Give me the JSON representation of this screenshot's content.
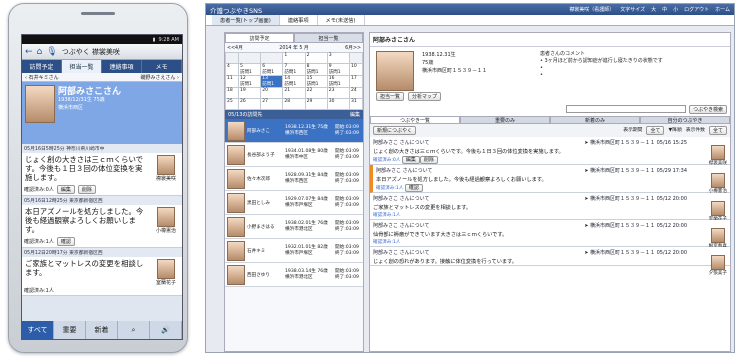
{
  "phone": {
    "status_time": "9:28 AM",
    "top_title": "つぶやく 襟裳美咲",
    "tabs": [
      "訪問予定",
      "担当一覧",
      "連絡事項",
      "メモ"
    ],
    "sub_left": "石井キミさん",
    "sub_right": "磯野みさえさん",
    "hero_name": "阿部みさこさん",
    "hero_meta": "1938/12/31生 75歳",
    "hero_city": "横浜市西区",
    "posts": [
      {
        "head": "05月16日5時25分 神奈川県川崎市中",
        "body": "じょく創の大きさは三ｃｍくらいです。今後も１日３回の体位変換を実施します。",
        "name": "襟裳美咲",
        "footer": [
          "確認済み:0人",
          "編集",
          "削除"
        ]
      },
      {
        "head": "05月16日12時25分 東京都新宿区西",
        "body": "本日アズノールを処方しました。今後も経過観察よろしくお願いします。",
        "name": "小樽憲治",
        "footer": [
          "確認済み:1人",
          "確認"
        ]
      },
      {
        "head": "05月12日20時17分 東京都新宿区西",
        "body": "ご家族とマットレスの変更を相談します。",
        "name": "室蘭花子",
        "footer": [
          "確認済み:1人"
        ]
      }
    ],
    "bottom": [
      "すべて",
      "重要",
      "新着"
    ]
  },
  "web": {
    "brand": "介護つぶやきSNS",
    "user": "襟裳美咲（看護師）",
    "links": [
      "文字サイズ",
      "大",
      "中",
      "小",
      "ログアウト",
      "ホーム"
    ],
    "nav": [
      "患者一覧(トップ画面)",
      "連絡事項",
      "メモ(未送信)"
    ],
    "left_tabs": [
      "訪問予定",
      "担当一覧"
    ],
    "month_label": "2014 年 5 月",
    "prev": "<<4月",
    "next": "6月>>",
    "visits_title": "05/13の訪問先",
    "visits_edit": "編集",
    "visits": [
      {
        "name": "阿部みさこ",
        "dob": "1938.12.31生 75歳",
        "city": "横浜市西区",
        "time": "開始:03:09 終了:03:09"
      },
      {
        "name": "長谷部よう子",
        "dob": "1934.01.08生 80歳",
        "city": "横浜市中区",
        "time": "開始:03:09 終了:03:09"
      },
      {
        "name": "佐々木次郎",
        "dob": "1928.09.31生 84歳",
        "city": "横浜市西区",
        "time": "開始:03:09 終了:03:09"
      },
      {
        "name": "黒田としみ",
        "dob": "1929.07.07生 84歳",
        "city": "横浜市戸塚区",
        "time": "開始:03:09 終了:03:09"
      },
      {
        "name": "小野まさはる",
        "dob": "1938.02.01生 76歳",
        "city": "横浜市港北区",
        "time": "開始:03:09 終了:03:09"
      },
      {
        "name": "石井キミ",
        "dob": "1932.01.01生 82歳",
        "city": "横浜市戸塚区",
        "time": "開始:03:09 終了:03:09"
      },
      {
        "name": "西田さゆり",
        "dob": "1938.03.14生 76歳",
        "city": "横浜市港北区",
        "time": "開始:03:09 終了:03:09"
      }
    ],
    "patient_title": "阿部みさこさん",
    "patient_dob": "1938.12.31生",
    "patient_age": "75歳",
    "patient_addr": "横浜市西区町１５３９－１１",
    "comment_title": "患者さんのコメント",
    "comment_items": [
      "3ヶ月ほど前から認知症が進行し寝たきりの状態です",
      "",
      ""
    ],
    "buttons": [
      "担当一覧",
      "分析マップ"
    ],
    "search_btn": "つぶやき検索",
    "feed_tabs": [
      "つぶやき一覧",
      "重要のみ",
      "新着のみ",
      "自分のつぶやき"
    ],
    "new_btn": "新規につぶやく",
    "period_label": "表示期間",
    "period_val": "全て",
    "order_label": "▼降順",
    "count_label": "表示件数",
    "count_val": "全て",
    "feeds": [
      {
        "who": "阿部みさこ さんについて",
        "loc": "横浜市西区町１５３９－１１",
        "date": "05/16 15:25",
        "text": "じょく創の大きさは三ｃｍくらいです。今後も１日３回の体位変換を実施します。",
        "name": "襟裳美咲",
        "confirm": "確認済み:0人",
        "acts": [
          "編集",
          "削除"
        ]
      },
      {
        "who": "阿部みさこ さんについて",
        "loc": "横浜市西区町１５３９－１１",
        "date": "05/29 17:34",
        "text": "本日アズノールを処方しました。今後も経過観察よろしくお願いします。",
        "name": "小樽憲治",
        "confirm": "確認済み:1人",
        "acts": [
          "確認"
        ]
      },
      {
        "who": "阿部みさこ さんについて",
        "loc": "横浜市西区町１５３９－１１",
        "date": "05/12 20:00",
        "text": "ご家族とマットレスの変更を相談します。",
        "name": "室蘭花子",
        "confirm": "確認済み:1人",
        "acts": []
      },
      {
        "who": "阿部みさこ さんについて",
        "loc": "横浜市西区町１５３９－１１",
        "date": "05/12 20:00",
        "text": "仙骨部に褥瘡ができています大きさは三ｃｍくらいです。",
        "name": "根室春喜",
        "confirm": "確認済み:1人",
        "acts": []
      },
      {
        "who": "阿部みさこ さんについて",
        "loc": "横浜市西区町１５３９－１１",
        "date": "05/12 20:00",
        "text": "じょく創の恐れがあります。接触に体位変換を行っています。",
        "name": "夕張美子",
        "confirm": "",
        "acts": []
      }
    ],
    "calendar": [
      [
        "",
        "",
        "",
        "1",
        "2",
        "3",
        ""
      ],
      [
        "4",
        "5",
        "6",
        "7",
        "8",
        "9",
        "10"
      ],
      [
        "11",
        "12",
        "13",
        "14",
        "15",
        "16",
        "17"
      ],
      [
        "18",
        "19",
        "20",
        "21",
        "22",
        "23",
        "24"
      ],
      [
        "25",
        "26",
        "27",
        "28",
        "29",
        "30",
        "31"
      ]
    ],
    "cal_note": "訪問1"
  }
}
